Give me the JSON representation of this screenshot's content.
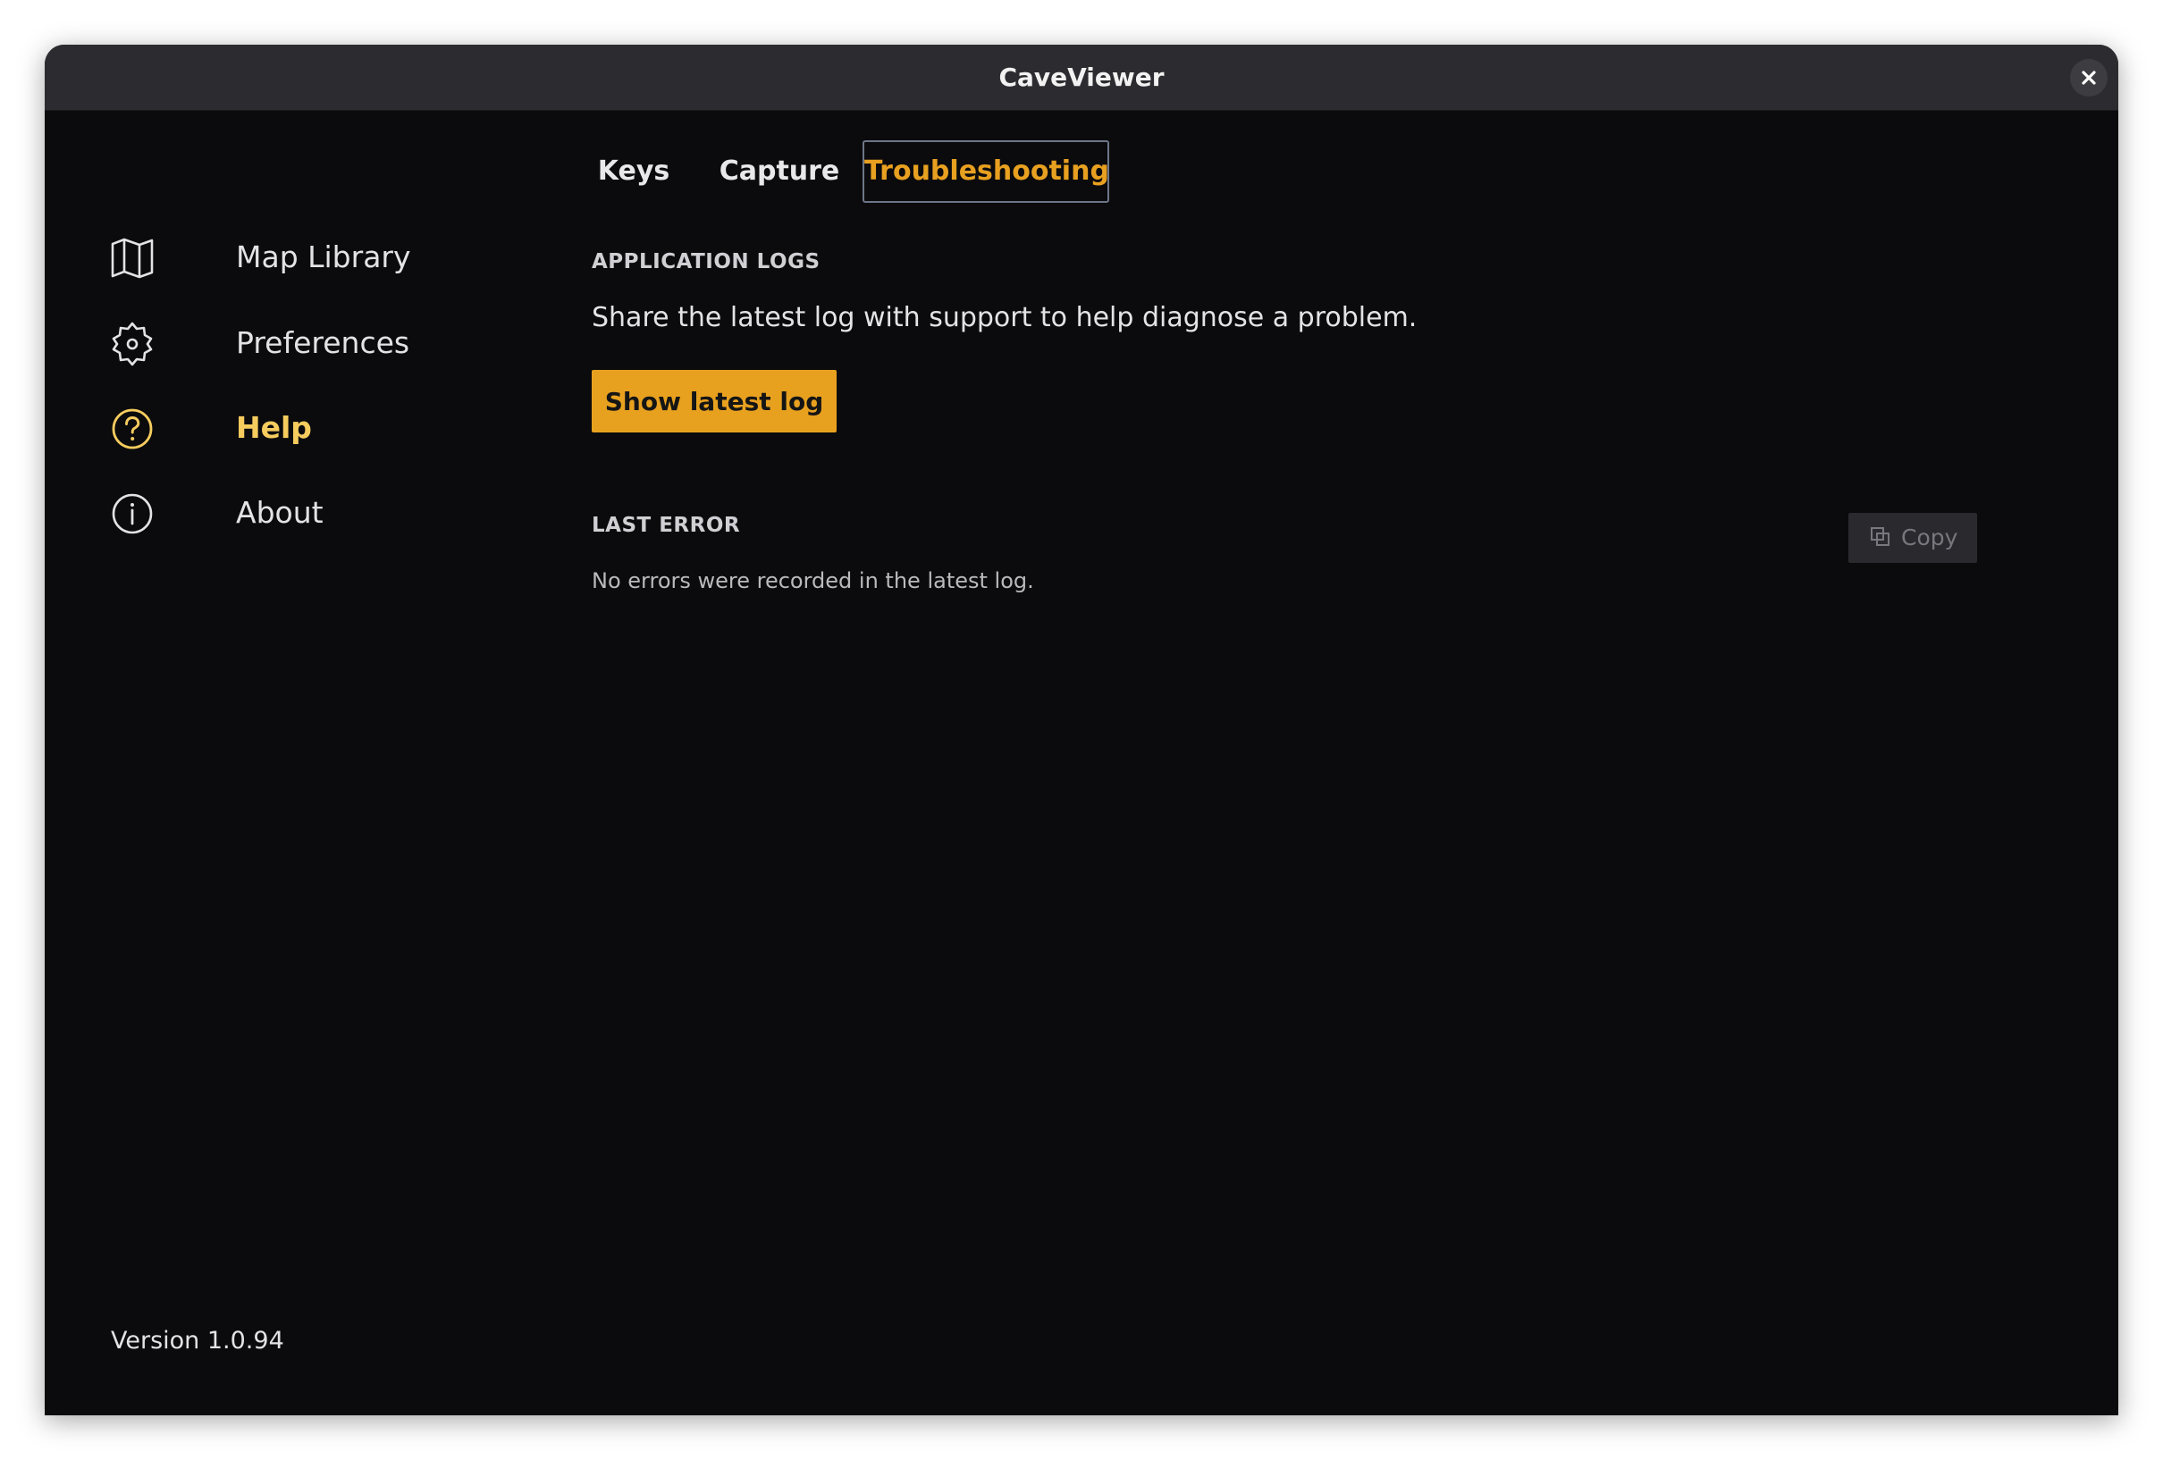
{
  "window": {
    "title": "CaveViewer"
  },
  "sidebar": {
    "items": [
      {
        "label": "Map Library",
        "icon": "map-icon",
        "active": false
      },
      {
        "label": "Preferences",
        "icon": "gear-icon",
        "active": false
      },
      {
        "label": "Help",
        "icon": "question-circle-icon",
        "active": true
      },
      {
        "label": "About",
        "icon": "info-circle-icon",
        "active": false
      }
    ],
    "version": "Version 1.0.94"
  },
  "tabs": [
    {
      "label": "Keys",
      "active": false
    },
    {
      "label": "Capture",
      "active": false
    },
    {
      "label": "Troubleshooting",
      "active": true
    }
  ],
  "logs": {
    "heading": "APPLICATION LOGS",
    "description": "Share the latest log with support to help diagnose a problem.",
    "button_label": "Show latest log"
  },
  "last_error": {
    "heading": "LAST ERROR",
    "copy_label": "Copy",
    "copy_icon": "copy-icon",
    "message": "No errors were recorded in the latest log."
  },
  "colors": {
    "accent": "#e8a11f",
    "active_nav": "#f6cc5e",
    "background": "#0b0b0d",
    "titlebar": "#2c2c30"
  }
}
